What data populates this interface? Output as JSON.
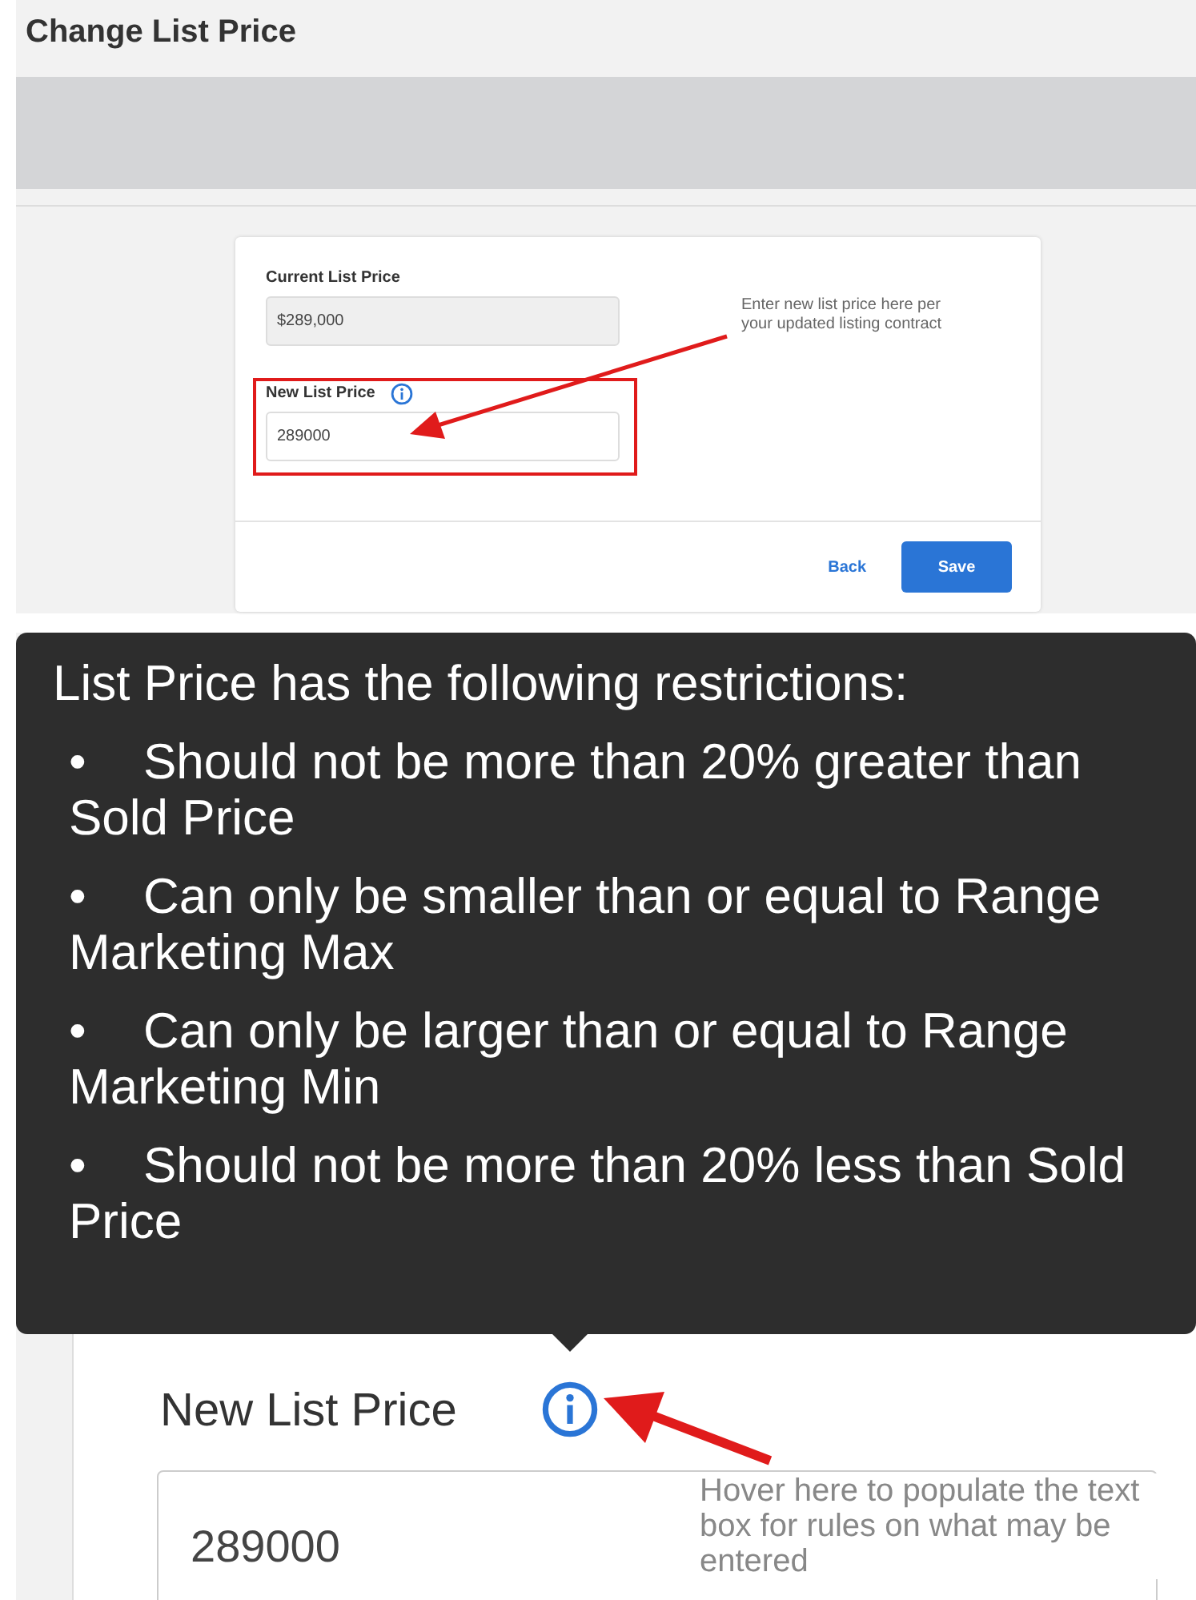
{
  "top_screenshot": {
    "page_title": "Change List Price",
    "fields": [
      {
        "label": "Current List Price",
        "value": "$289,000",
        "kind": "readonly"
      },
      {
        "label": "New List Price",
        "value": "289000",
        "kind": "input"
      }
    ],
    "buttons": [
      {
        "label": "Back",
        "kind": "link"
      },
      {
        "label": "Save",
        "kind": "primary"
      }
    ],
    "annotation": "Enter new list price here per your updated listing contract"
  },
  "bottom_screenshot": {
    "tooltip": {
      "heading": "List Price has the following restrictions:",
      "items": [
        "•\tShould not be more than 20% greater than Sold Price",
        "•\tCan only be smaller than or equal to Range Marketing Max",
        "•\tCan only be larger than or equal to Range Marketing Min",
        "•\tShould not be more than 20% less than Sold Price"
      ]
    },
    "field": {
      "label": "New List Price",
      "value": "289000"
    },
    "annotation": "Hover here to populate the text box for rules on what may be entered"
  }
}
